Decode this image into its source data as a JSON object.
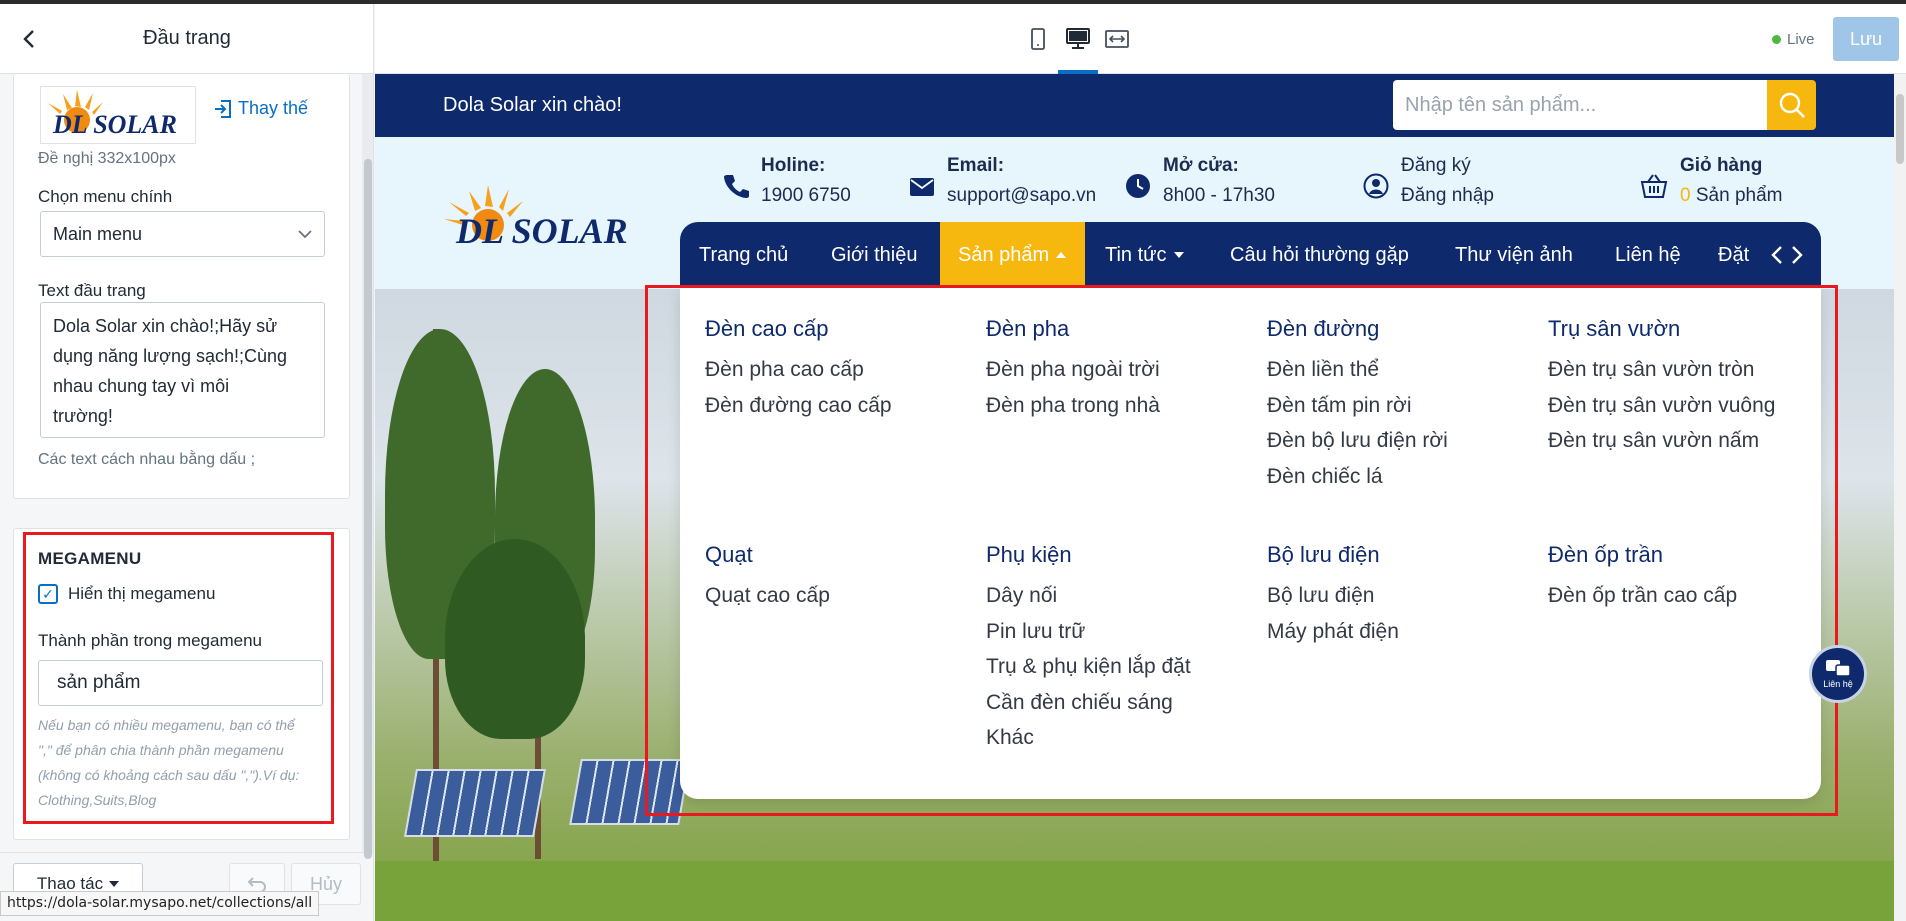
{
  "panel": {
    "title": "Đầu trang",
    "replace_label": "Thay thế",
    "logo_hint": "Đề nghị 332x100px",
    "menu_label": "Chọn menu chính",
    "menu_value": "Main menu",
    "header_text_label": "Text đầu trang",
    "header_text_lines": [
      "Dola Solar xin chào!;Hãy sử",
      "dụng năng lượng sạch!;Cùng",
      "nhau chung tay vì môi",
      "trường!"
    ],
    "header_text_hint": "Các text cách nhau bằng dấu ;",
    "megamenu": {
      "title": "MEGAMENU",
      "show_label": "Hiển thị megamenu",
      "component_label": "Thành phần trong megamenu",
      "component_value": "sản phẩm",
      "help_lines": [
        "Nếu bạn có nhiều megamenu, bạn có thể",
        "\",\" để phân chia thành phần megamenu",
        "(không có khoảng cách sau dấu \",\").Ví dụ:",
        "Clothing,Suits,Blog"
      ]
    },
    "action_label": "Thao tác",
    "cancel_label": "Hủy",
    "status_url": "https://dola-solar.mysapo.net/collections/all"
  },
  "editor": {
    "live_label": "Live",
    "save_label": "Lưu"
  },
  "site": {
    "welcome": "Dola Solar xin chào!",
    "search_placeholder": "Nhập tên sản phẩm...",
    "logo_text": "DL SOLAR",
    "info": {
      "hotline_label": "Holine:",
      "hotline_value": "1900 6750",
      "email_label": "Email:",
      "email_value": "support@sapo.vn",
      "open_label": "Mở cửa:",
      "open_value": "8h00 - 17h30",
      "register": "Đăng ký",
      "login": "Đăng nhập",
      "cart_label": "Giỏ hàng",
      "cart_count": "0",
      "cart_unit": "Sản phẩm"
    },
    "nav": [
      "Trang chủ",
      "Giới thiệu",
      "Sản phẩm",
      "Tin tức",
      "Câu hỏi thường gặp",
      "Thư viện ảnh",
      "Liên hệ",
      "Đặt"
    ],
    "mega": [
      {
        "title": "Đèn cao cấp",
        "items": [
          "Đèn pha cao cấp",
          "Đèn đường cao cấp"
        ]
      },
      {
        "title": "Đèn pha",
        "items": [
          "Đèn pha ngoài trời",
          "Đèn pha trong nhà"
        ]
      },
      {
        "title": "Đèn đường",
        "items": [
          "Đèn liền thể",
          "Đèn tấm pin rời",
          "Đèn bộ lưu điện rời",
          "Đèn chiếc lá"
        ]
      },
      {
        "title": "Trụ sân vườn",
        "items": [
          "Đèn trụ sân vườn tròn",
          "Đèn trụ sân vườn vuông",
          "Đèn trụ sân vườn nấm"
        ]
      },
      {
        "title": "Quạt",
        "items": [
          "Quạt cao cấp"
        ]
      },
      {
        "title": "Phụ kiện",
        "items": [
          "Dây nối",
          "Pin lưu trữ",
          "Trụ & phụ kiện lắp đặt",
          "Cần đèn chiếu sáng",
          "Khác"
        ]
      },
      {
        "title": "Bộ lưu điện",
        "items": [
          "Bộ lưu điện",
          "Máy phát điện"
        ]
      },
      {
        "title": "Đèn ốp trần",
        "items": [
          "Đèn ốp trần cao cấp"
        ]
      }
    ],
    "chat_label": "Liên hệ"
  },
  "colors": {
    "navy": "#0e2a6c",
    "accent": "#f6b80f",
    "link": "#0a6fc2",
    "highlight": "#e8191f"
  }
}
